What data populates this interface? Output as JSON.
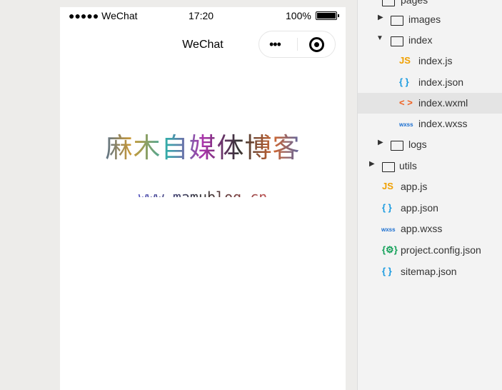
{
  "status": {
    "carrier": "●●●●● WeChat",
    "time": "17:20",
    "battery": "100%"
  },
  "nav": {
    "title": "WeChat",
    "more": "•••"
  },
  "content": {
    "title": "麻木自媒体博客",
    "url": "www.mamublog.cn"
  },
  "tree": [
    {
      "label": "pages",
      "icon": "folder-open-icon"
    },
    {
      "label": "images",
      "icon": "folder-icon"
    },
    {
      "label": "index",
      "icon": "folder-open-icon"
    },
    {
      "label": "index.js",
      "icon": "js-file-icon",
      "glyph": "JS"
    },
    {
      "label": "index.json",
      "icon": "json-file-icon",
      "glyph": "{ }"
    },
    {
      "label": "index.wxml",
      "icon": "wxml-file-icon",
      "glyph": "< >"
    },
    {
      "label": "index.wxss",
      "icon": "wxss-file-icon",
      "glyph": "wxss"
    },
    {
      "label": "logs",
      "icon": "folder-icon"
    },
    {
      "label": "utils",
      "icon": "folder-icon"
    },
    {
      "label": "app.js",
      "icon": "js-file-icon",
      "glyph": "JS"
    },
    {
      "label": "app.json",
      "icon": "json-file-icon",
      "glyph": "{ }"
    },
    {
      "label": "app.wxss",
      "icon": "wxss-file-icon",
      "glyph": "wxss"
    },
    {
      "label": "project.config.json",
      "icon": "config-file-icon",
      "glyph": "{⚙}"
    },
    {
      "label": "sitemap.json",
      "icon": "json-file-icon",
      "glyph": "{ }"
    }
  ]
}
